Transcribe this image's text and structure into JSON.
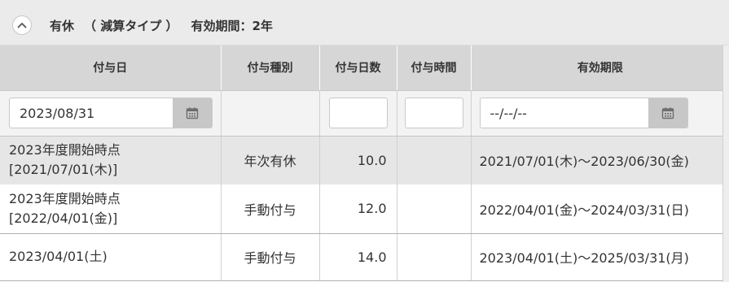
{
  "panel": {
    "title_leave": "有休",
    "title_calc_type": "（ 減算タイプ ）",
    "title_validity": "有効期間：2年",
    "toggle_icon": "chevron-up-icon"
  },
  "columns": [
    "付与日",
    "付与種別",
    "付与日数",
    "付与時間",
    "有効期限"
  ],
  "filters": {
    "grant_date_value": "2023/08/31",
    "grant_days_value": "",
    "grant_time_value": "",
    "expiry_value": "--/--/--",
    "calendar_icon": "calendar-icon"
  },
  "rows": [
    {
      "date_line1": "2023年度開始時点",
      "date_line2": "[2021/07/01(木)]",
      "type": "年次有休",
      "days": "10.0",
      "time": "",
      "period": "2021/07/01(木)～2023/06/30(金)"
    },
    {
      "date_line1": "2023年度開始時点",
      "date_line2": "[2022/04/01(金)]",
      "type": "手動付与",
      "days": "12.0",
      "time": "",
      "period": "2022/04/01(金)～2024/03/31(日)"
    },
    {
      "date_line1": "2023/04/01(土)",
      "date_line2": "",
      "type": "手動付与",
      "days": "14.0",
      "time": "",
      "period": "2023/04/01(土)～2025/03/31(月)"
    }
  ],
  "colors": {
    "header_bg": "#ebebeb",
    "column_header_bg": "#d6d6d6",
    "highlight_row_bg": "#e6e6e6",
    "calendar_button_bg": "#c7c7c7"
  }
}
